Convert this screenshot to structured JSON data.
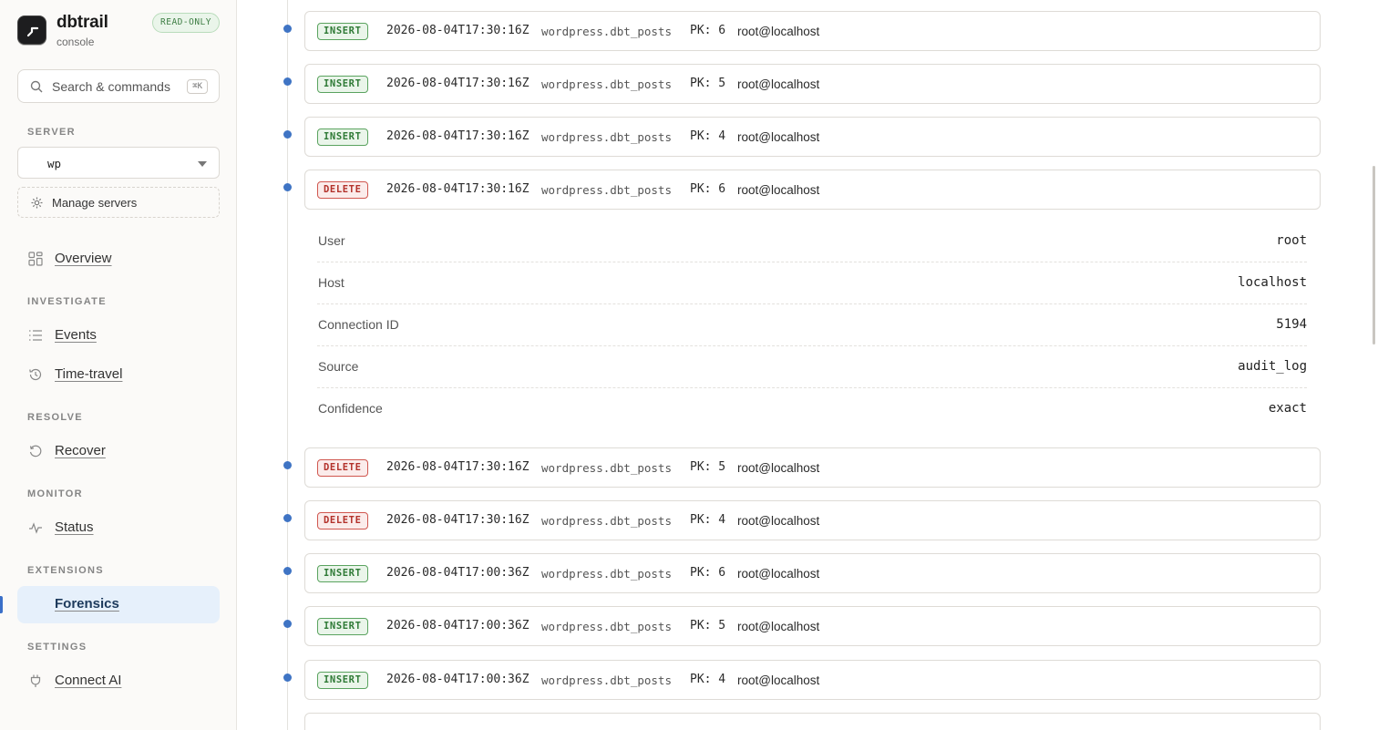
{
  "brand": {
    "name": "dbtrail",
    "subtitle": "console",
    "badge": "READ-ONLY"
  },
  "search": {
    "placeholder": "Search & commands",
    "shortcut": "⌘K"
  },
  "server": {
    "section_label": "SERVER",
    "selected": "wp",
    "manage_label": "Manage servers"
  },
  "nav": {
    "overview": "Overview",
    "investigate_label": "INVESTIGATE",
    "events": "Events",
    "time_travel": "Time-travel",
    "resolve_label": "RESOLVE",
    "recover": "Recover",
    "monitor_label": "MONITOR",
    "status": "Status",
    "extensions_label": "EXTENSIONS",
    "forensics": "Forensics",
    "settings_label": "SETTINGS",
    "connect_ai": "Connect AI"
  },
  "events": [
    {
      "type": "INSERT",
      "timestamp": "2026-08-04T17:30:16Z",
      "table": "wordpress.dbt_posts",
      "pk": "PK: 6",
      "user": "root@localhost"
    },
    {
      "type": "INSERT",
      "timestamp": "2026-08-04T17:30:16Z",
      "table": "wordpress.dbt_posts",
      "pk": "PK: 5",
      "user": "root@localhost"
    },
    {
      "type": "INSERT",
      "timestamp": "2026-08-04T17:30:16Z",
      "table": "wordpress.dbt_posts",
      "pk": "PK: 4",
      "user": "root@localhost"
    },
    {
      "type": "DELETE",
      "timestamp": "2026-08-04T17:30:16Z",
      "table": "wordpress.dbt_posts",
      "pk": "PK: 6",
      "user": "root@localhost"
    },
    {
      "type": "DELETE",
      "timestamp": "2026-08-04T17:30:16Z",
      "table": "wordpress.dbt_posts",
      "pk": "PK: 5",
      "user": "root@localhost"
    },
    {
      "type": "DELETE",
      "timestamp": "2026-08-04T17:30:16Z",
      "table": "wordpress.dbt_posts",
      "pk": "PK: 4",
      "user": "root@localhost"
    },
    {
      "type": "INSERT",
      "timestamp": "2026-08-04T17:00:36Z",
      "table": "wordpress.dbt_posts",
      "pk": "PK: 6",
      "user": "root@localhost"
    },
    {
      "type": "INSERT",
      "timestamp": "2026-08-04T17:00:36Z",
      "table": "wordpress.dbt_posts",
      "pk": "PK: 5",
      "user": "root@localhost"
    },
    {
      "type": "INSERT",
      "timestamp": "2026-08-04T17:00:36Z",
      "table": "wordpress.dbt_posts",
      "pk": "PK: 4",
      "user": "root@localhost"
    }
  ],
  "details": [
    {
      "key": "User",
      "value": "root"
    },
    {
      "key": "Host",
      "value": "localhost"
    },
    {
      "key": "Connection ID",
      "value": "5194"
    },
    {
      "key": "Source",
      "value": "audit_log"
    },
    {
      "key": "Confidence",
      "value": "exact"
    }
  ],
  "colors": {
    "accent": "#3f74c4",
    "insert": "#2f7a36",
    "delete": "#b3322b",
    "active_nav_bg": "#e6f0fb"
  }
}
